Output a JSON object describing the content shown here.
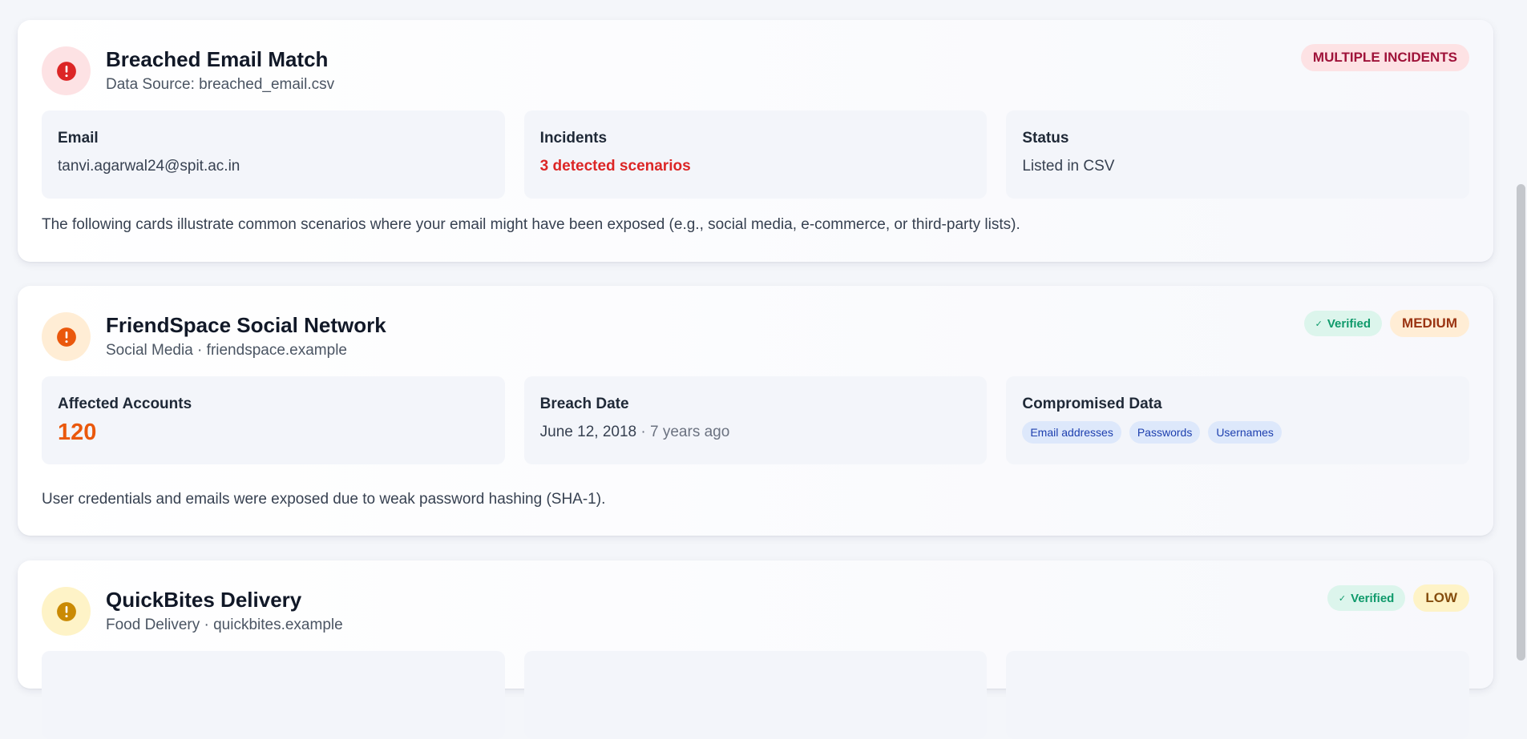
{
  "cards": [
    {
      "title": "Breached Email Match",
      "subtitle": "Data Source: breached_email.csv",
      "severity": "MULTIPLE INCIDENTS",
      "icon": "alert-circle-icon",
      "accent": "#dc2626",
      "panels": {
        "email_label": "Email",
        "email_value": "tanvi.agarwal24@spit.ac.in",
        "incidents_label": "Incidents",
        "incidents_value": "3 detected scenarios",
        "status_label": "Status",
        "status_value": "Listed in CSV"
      },
      "description": "The following cards illustrate common scenarios where your email might have been exposed (e.g., social media, e-commerce, or third-party lists)."
    },
    {
      "title": "FriendSpace Social Network",
      "subtitle": "Social Media · friendspace.example",
      "verified": "Verified",
      "severity": "MEDIUM",
      "icon": "alert-circle-icon",
      "accent": "#ea580c",
      "panels": {
        "affected_label": "Affected Accounts",
        "affected_value": "120",
        "date_label": "Breach Date",
        "date_value": "June 12, 2018",
        "date_ago": " · 7 years ago",
        "data_label": "Compromised Data",
        "data_items": [
          "Email addresses",
          "Passwords",
          "Usernames"
        ]
      },
      "description": "User credentials and emails were exposed due to weak password hashing (SHA-1)."
    },
    {
      "title": "QuickBites Delivery",
      "subtitle": "Food Delivery · quickbites.example",
      "verified": "Verified",
      "severity": "LOW",
      "icon": "alert-circle-icon",
      "accent": "#ca8a04"
    }
  ],
  "colors": {
    "high_bg": "#fde2e4",
    "high_text": "#9f1239",
    "medium_bg": "#ffedd5",
    "medium_text": "#9a3412",
    "low_bg": "#fef3c7",
    "low_text": "#854d0e",
    "verified_bg": "#dcf5ec",
    "verified_text": "#0f9a6b"
  }
}
